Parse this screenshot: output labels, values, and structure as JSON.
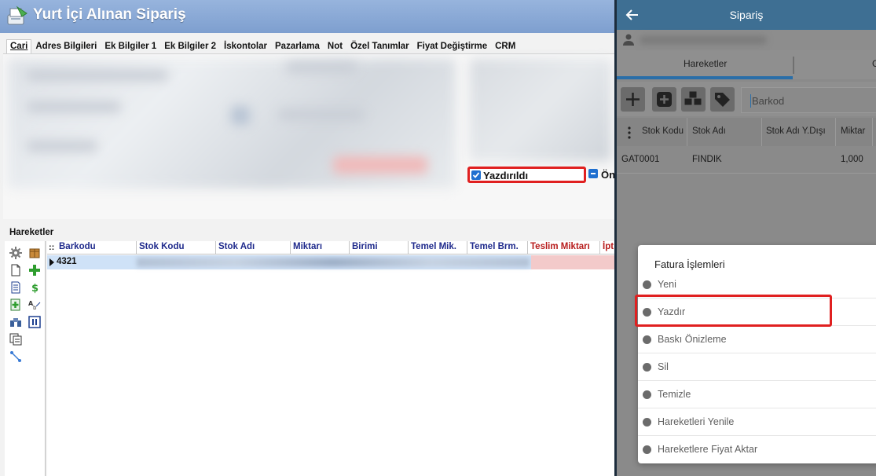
{
  "desktop": {
    "window_title": "Yurt İçi Alınan Sipariş",
    "tabs": [
      {
        "label": "Cari",
        "active": true
      },
      {
        "label": "Adres Bilgileri"
      },
      {
        "label": "Ek Bilgiler 1"
      },
      {
        "label": "Ek Bilgiler 2"
      },
      {
        "label": "İskontolar"
      },
      {
        "label": "Pazarlama"
      },
      {
        "label": "Not"
      },
      {
        "label": "Özel Tanımlar"
      },
      {
        "label": "Fiyat Değiştirme"
      },
      {
        "label": "CRM"
      }
    ],
    "printed_checkbox": {
      "label": "Yazdırıldı",
      "checked": true
    },
    "on_checkbox_label": "Ön",
    "movements_label": "Hareketler",
    "grid": {
      "columns": [
        "Barkodu",
        "Stok Kodu",
        "Stok Adı",
        "Miktarı",
        "Birimi",
        "Temel Mik.",
        "Temel Brm.",
        "Teslim Miktarı",
        "İpt"
      ],
      "rows": [
        {
          "barkodu": "4321"
        }
      ],
      "row_marker": "::"
    },
    "colors": {
      "title_bar": "#8aa9d6",
      "highlight": "#e02020",
      "header_text": "#1f2a8c",
      "selected_row": "#cfe2f7"
    }
  },
  "mobile": {
    "title": "Sipariş",
    "tabs": [
      {
        "label": "Hareketler",
        "active": true
      },
      {
        "label": "G"
      }
    ],
    "search_placeholder": "Barkod",
    "table": {
      "columns": [
        "Stok Kodu",
        "Stok Adı",
        "Stok Adı Y.Dışı",
        "Miktar"
      ],
      "rows": [
        {
          "stok_kodu": "GAT0001",
          "stok_adi": "FINDIK",
          "stok_adi_ydisi": "",
          "miktar": "1,000"
        }
      ]
    },
    "menu": {
      "title": "Fatura İşlemleri",
      "items": [
        "Yeni",
        "Yazdır",
        "Baskı Önizleme",
        "Sil",
        "Temizle",
        "Hareketleri Yenile",
        "Hareketlere Fiyat Aktar"
      ],
      "highlighted": "Yazdır"
    },
    "colors": {
      "app_bar": "#3e6f93",
      "tab_indicator": "#2a6ea8"
    }
  }
}
